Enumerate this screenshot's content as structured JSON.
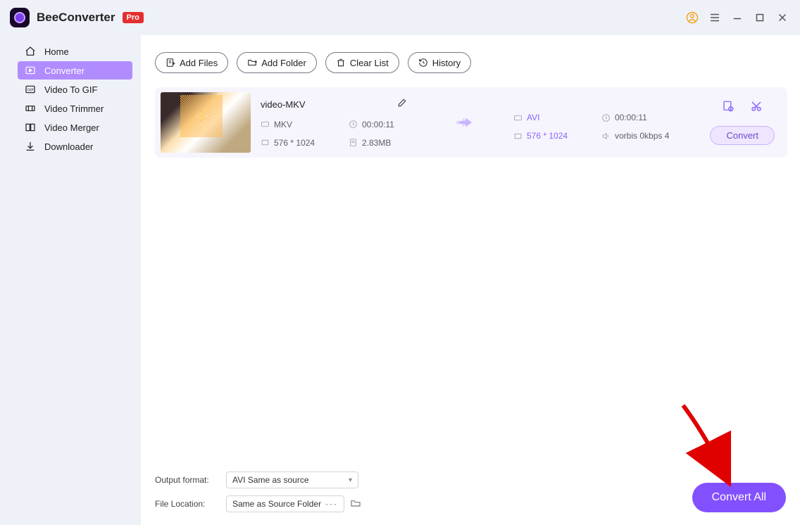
{
  "titlebar": {
    "brand": "BeeConverter",
    "pro_label": "Pro"
  },
  "sidebar": {
    "items": [
      {
        "icon": "home-icon",
        "label": "Home"
      },
      {
        "icon": "converter-icon",
        "label": "Converter",
        "active": true
      },
      {
        "icon": "gif-icon",
        "label": "Video To GIF"
      },
      {
        "icon": "trimmer-icon",
        "label": "Video Trimmer"
      },
      {
        "icon": "merger-icon",
        "label": "Video Merger"
      },
      {
        "icon": "download-icon",
        "label": "Downloader"
      }
    ]
  },
  "toolbar": {
    "add_files": "Add Files",
    "add_folder": "Add Folder",
    "clear_list": "Clear List",
    "history": "History"
  },
  "file": {
    "title": "video-MKV",
    "src": {
      "format": "MKV",
      "duration": "00:00:11",
      "resolution": "576 * 1024",
      "size": "2.83MB"
    },
    "dst": {
      "format": "AVI",
      "duration": "00:00:11",
      "resolution": "576 * 1024",
      "audio": "vorbis 0kbps 4"
    },
    "convert_label": "Convert"
  },
  "footer": {
    "output_format_label": "Output format:",
    "output_format_value": "AVI Same as source",
    "file_location_label": "File Location:",
    "file_location_value": "Same as Source Folder",
    "convert_all_label": "Convert All"
  }
}
